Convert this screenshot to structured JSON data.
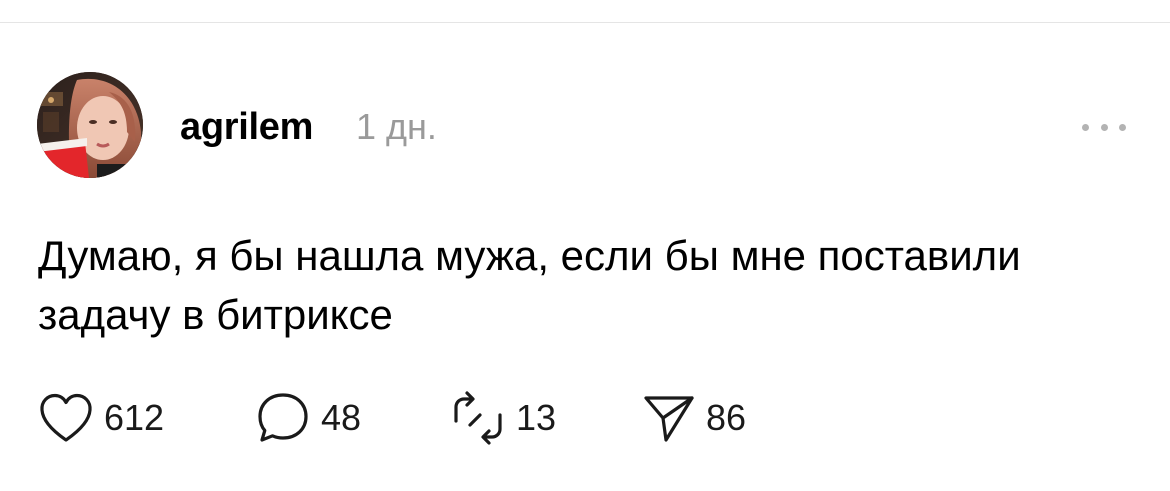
{
  "post": {
    "author": {
      "username": "agrilem",
      "avatar_icon": "user-avatar-photo"
    },
    "timestamp": "1 дн.",
    "text": "Думаю, я бы нашла мужа, если бы мне поставили\nзадачу в битриксе",
    "actions": {
      "like": {
        "icon": "heart-icon",
        "count": "612"
      },
      "comment": {
        "icon": "comment-bubble-icon",
        "count": "48"
      },
      "repost": {
        "icon": "repost-icon",
        "count": "13"
      },
      "share": {
        "icon": "send-icon",
        "count": "86"
      }
    },
    "menu_icon": "more-options-icon"
  },
  "colors": {
    "text": "#000000",
    "muted": "#9a9a9a",
    "icon": "#1a1a1a",
    "divider": "#e5e5e5"
  }
}
